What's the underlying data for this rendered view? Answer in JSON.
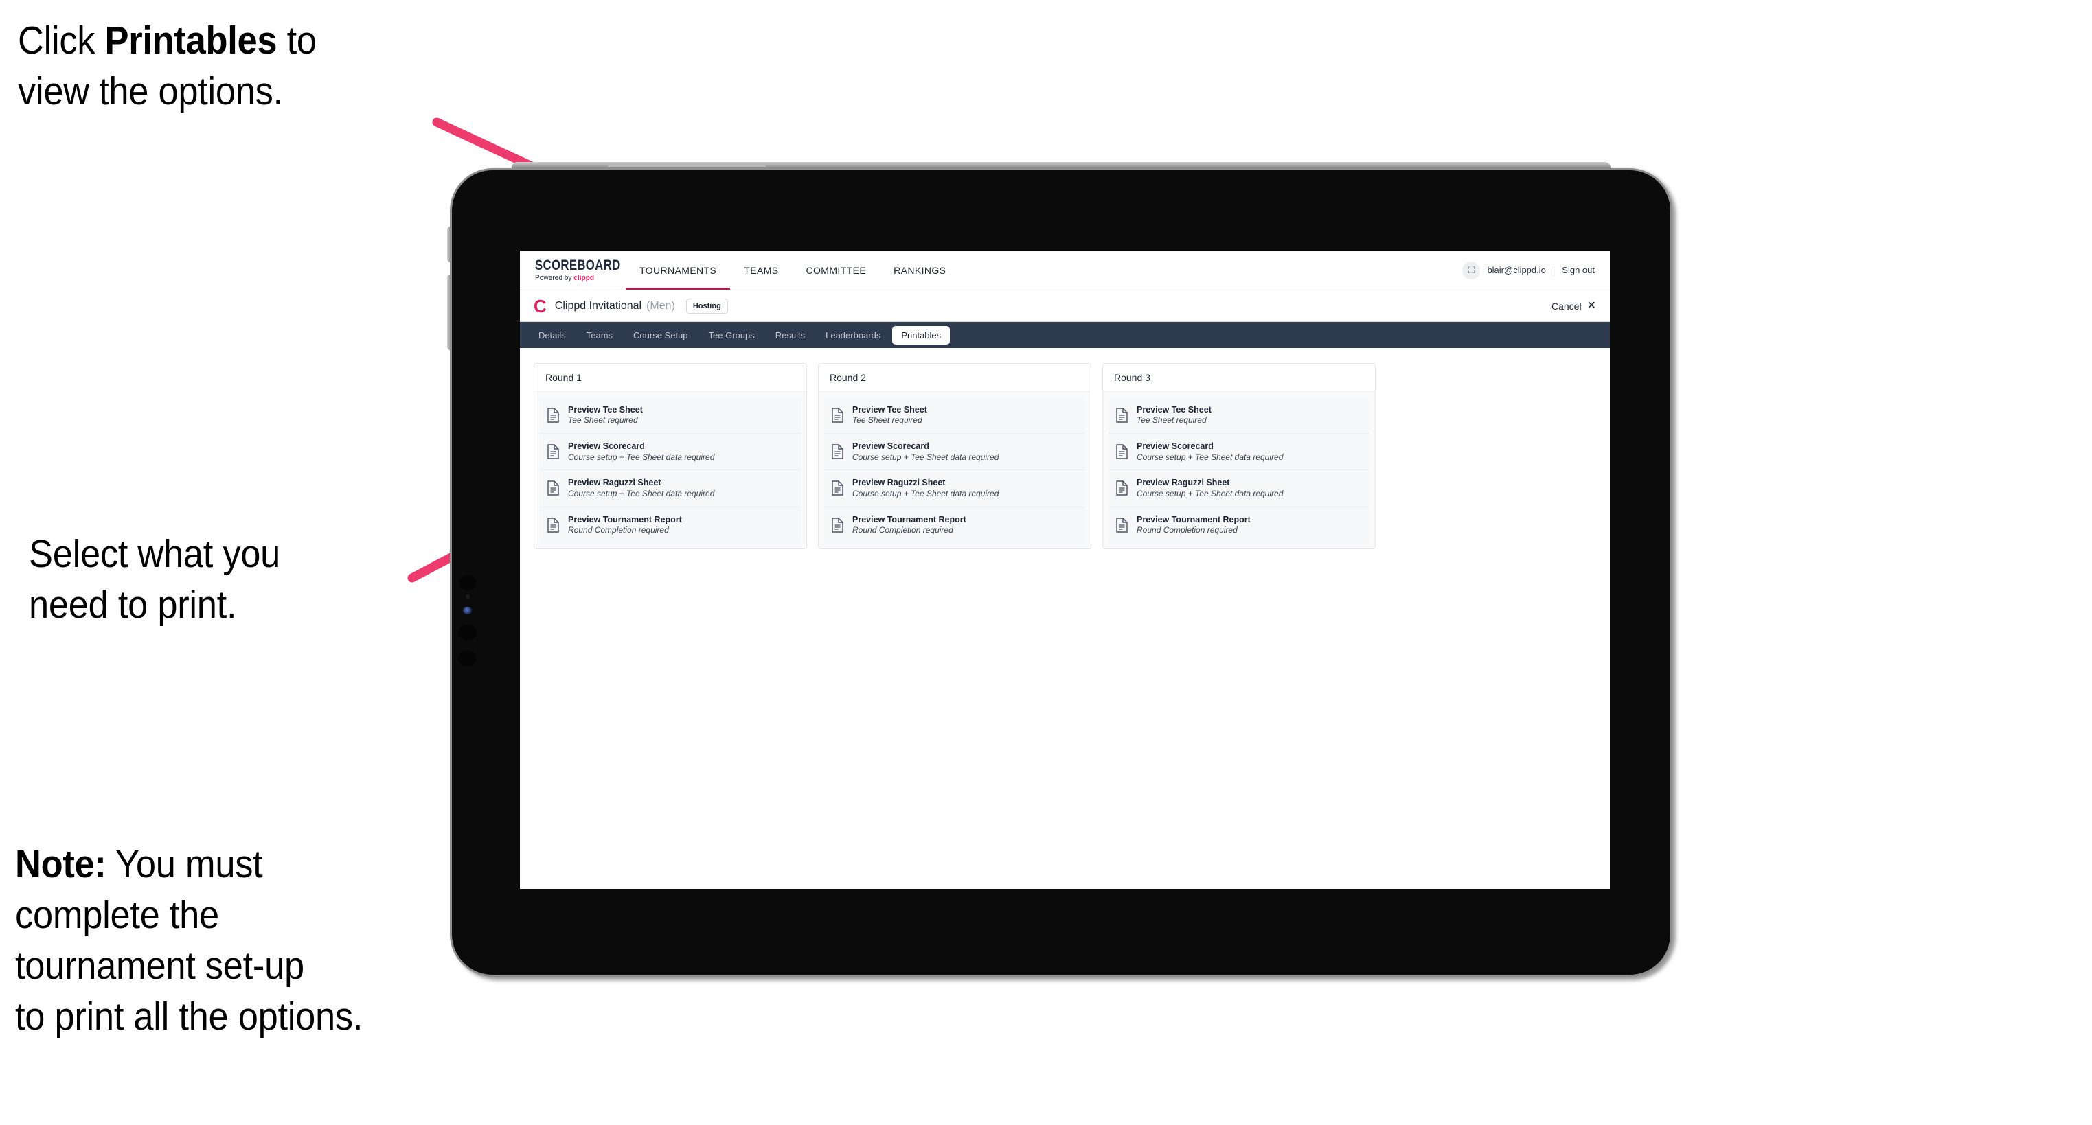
{
  "annotations": {
    "click_printables": {
      "prefix": "Click ",
      "bold": "Printables",
      "suffix": " to\nview the options."
    },
    "select_print": {
      "text": "Select what you\n need to print."
    },
    "note": {
      "bold": "Note:",
      "text": " You must\ncomplete the\ntournament set-up\nto print all the options."
    }
  },
  "colors": {
    "arrow_pink": "#ed3b6e",
    "brand_pink": "#e0245e",
    "nav_active_underline": "#a61d4d",
    "subnav_background": "#2e3a4e",
    "tablet_body": "#0b0b0b"
  },
  "app": {
    "topbar": {
      "brand_name": "SCOREBOARD",
      "brand_sub_prefix": "Powered by ",
      "brand_sub_mark": "clippd",
      "nav": [
        {
          "label": "TOURNAMENTS",
          "active": true
        },
        {
          "label": "TEAMS",
          "active": false
        },
        {
          "label": "COMMITTEE",
          "active": false
        },
        {
          "label": "RANKINGS",
          "active": false
        }
      ],
      "avatar_glyph": "⛶",
      "user_email": "blair@clippd.io",
      "separator": "|",
      "sign_out": "Sign out"
    },
    "tournament_header": {
      "logo_letter": "C",
      "title": "Clippd Invitational",
      "gender": "(Men)",
      "status_badge": "Hosting",
      "cancel_label": "Cancel",
      "cancel_icon": "✕"
    },
    "subnav": {
      "tabs": [
        {
          "label": "Details",
          "active": false
        },
        {
          "label": "Teams",
          "active": false
        },
        {
          "label": "Course Setup",
          "active": false
        },
        {
          "label": "Tee Groups",
          "active": false
        },
        {
          "label": "Results",
          "active": false
        },
        {
          "label": "Leaderboards",
          "active": false
        },
        {
          "label": "Printables",
          "active": true
        }
      ]
    },
    "rounds": [
      {
        "title": "Round 1",
        "items": [
          {
            "title": "Preview Tee Sheet",
            "subtitle": "Tee Sheet required"
          },
          {
            "title": "Preview Scorecard",
            "subtitle": "Course setup + Tee Sheet data required"
          },
          {
            "title": "Preview Raguzzi Sheet",
            "subtitle": "Course setup + Tee Sheet data required"
          },
          {
            "title": "Preview Tournament Report",
            "subtitle": "Round Completion required"
          }
        ]
      },
      {
        "title": "Round 2",
        "items": [
          {
            "title": "Preview Tee Sheet",
            "subtitle": "Tee Sheet required"
          },
          {
            "title": "Preview Scorecard",
            "subtitle": "Course setup + Tee Sheet data required"
          },
          {
            "title": "Preview Raguzzi Sheet",
            "subtitle": "Course setup + Tee Sheet data required"
          },
          {
            "title": "Preview Tournament Report",
            "subtitle": "Round Completion required"
          }
        ]
      },
      {
        "title": "Round 3",
        "items": [
          {
            "title": "Preview Tee Sheet",
            "subtitle": "Tee Sheet required"
          },
          {
            "title": "Preview Scorecard",
            "subtitle": "Course setup + Tee Sheet data required"
          },
          {
            "title": "Preview Raguzzi Sheet",
            "subtitle": "Course setup + Tee Sheet data required"
          },
          {
            "title": "Preview Tournament Report",
            "subtitle": "Round Completion required"
          }
        ]
      }
    ]
  }
}
